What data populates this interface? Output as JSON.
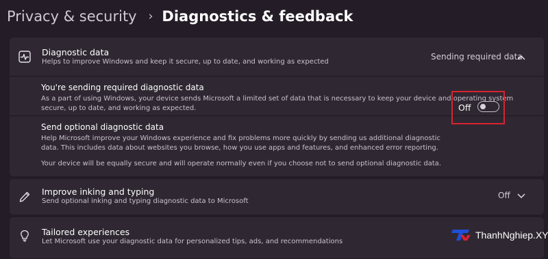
{
  "breadcrumb": {
    "parent": "Privacy & security",
    "separator": "›",
    "current": "Diagnostics & feedback"
  },
  "diagnostic_data": {
    "title": "Diagnostic data",
    "description": "Helps to improve Windows and keep it secure, up to date, and working as expected",
    "status": "Sending required data",
    "icon": "pulse-icon",
    "expanded": true,
    "required": {
      "title": "You're sending required diagnostic data",
      "description": "As a part of using Windows, your device sends Microsoft a limited set of data that is necessary to keep your device and operating system secure, up to date, and working as expected."
    },
    "optional": {
      "title": "Send optional diagnostic data",
      "description": "Help Microsoft improve your Windows experience and fix problems more quickly by sending us additional diagnostic data. This includes data about websites you browse, how you use apps and features, and enhanced error reporting.",
      "note": "Your device will be equally secure and will operate normally even if you choose not to send optional diagnostic data.",
      "toggle_label": "Off",
      "toggle_on": false,
      "highlight_color": "#d9232f"
    }
  },
  "inking": {
    "title": "Improve inking and typing",
    "description": "Send optional inking and typing diagnostic data to Microsoft",
    "status": "Off",
    "icon": "pen-icon"
  },
  "tailored": {
    "title": "Tailored experiences",
    "description": "Let Microsoft use your diagnostic data for personalized tips, ads, and recommendations",
    "icon": "lightbulb-icon"
  },
  "watermark": {
    "text": "ThanhNghiep.XYZ"
  },
  "colors": {
    "background": "#241c26",
    "card": "#2f2832",
    "accent_logo": "#1e4fd8"
  }
}
